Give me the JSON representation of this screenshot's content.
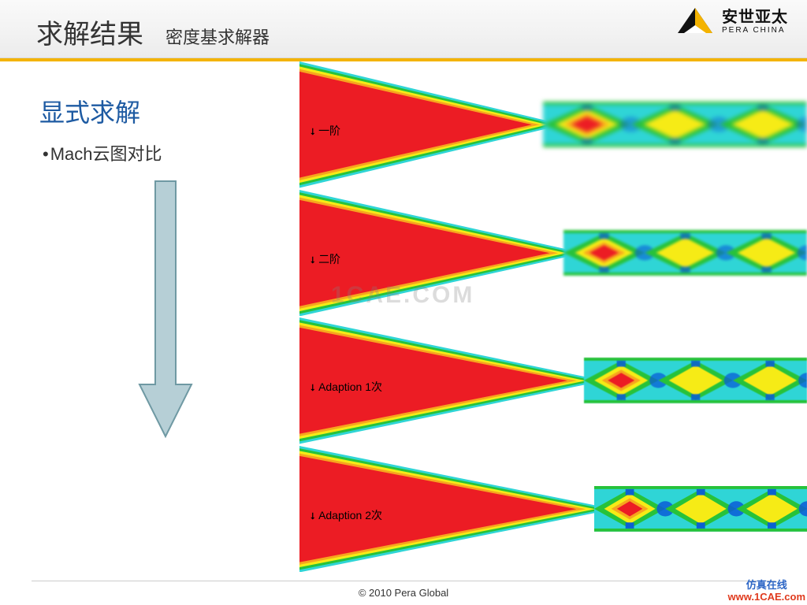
{
  "header": {
    "title_main": "求解结果",
    "title_sub": "密度基求解器",
    "brand_name": "安世亚太",
    "brand_sub": "PERA CHINA"
  },
  "content": {
    "subheading": "显式求解",
    "bullet": "Mach云图对比",
    "panels": [
      {
        "label": "一阶"
      },
      {
        "label": "二阶"
      },
      {
        "label": "Adaption 1次"
      },
      {
        "label": "Adaption 2次"
      }
    ],
    "center_watermark": "1CAE.COM"
  },
  "footer": {
    "copyright": "© 2010 Pera Global",
    "corner_wm_zh": "仿真在线",
    "corner_wm_url": "www.1CAE.com"
  },
  "colors": {
    "red": "#ec1c24",
    "orange": "#f7a51e",
    "yellow": "#f6eb16",
    "green": "#27c23a",
    "cyan": "#2fd5d6",
    "blue": "#0a5cd7",
    "arrow_fill": "#b6cfd6",
    "arrow_stroke": "#6f99a3"
  }
}
